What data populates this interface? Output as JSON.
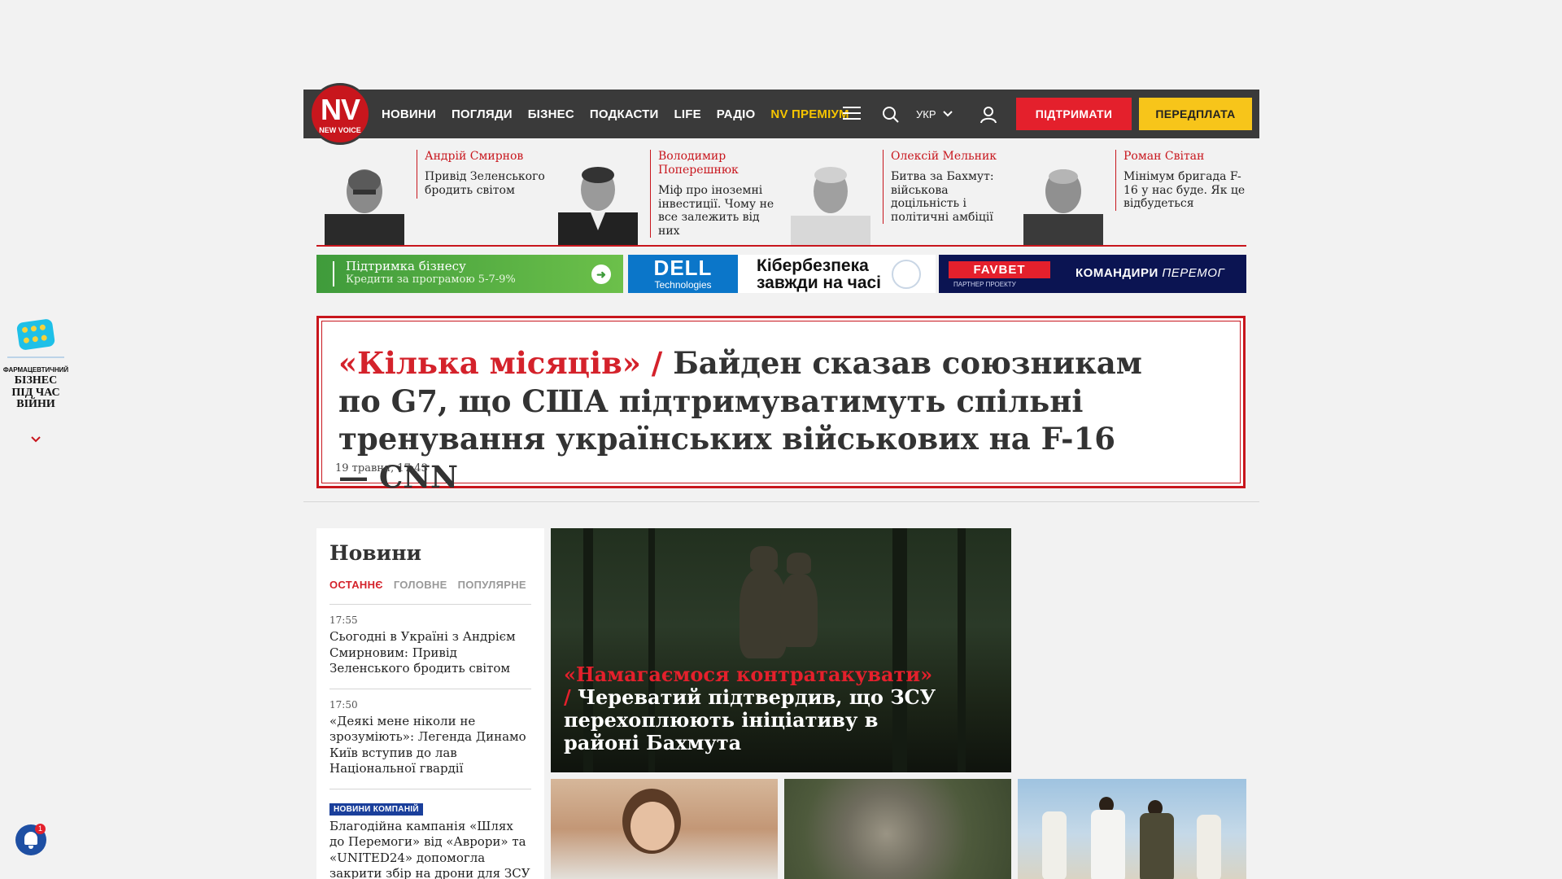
{
  "header": {
    "logo": {
      "main": "NV",
      "sub": "NEW VOICE"
    },
    "nav": [
      {
        "label": "НОВИНИ"
      },
      {
        "label": "ПОГЛЯДИ"
      },
      {
        "label": "БІЗНЕС"
      },
      {
        "label": "ПОДКАСТИ"
      },
      {
        "label": "LIFE"
      },
      {
        "label": "РАДІО"
      },
      {
        "label": "NV ПРЕМІУМ"
      }
    ],
    "icons": {
      "menu": "hamburger-menu-icon",
      "search": "search-icon",
      "user": "user-icon",
      "lang_arrow": "chevron-down-icon"
    },
    "language": "УКР",
    "support_label": "ПІДТРИМАТИ",
    "subscribe_label": "ПЕРЕДПЛАТА",
    "colors": {
      "bar": "#3a3a3a",
      "accent": "#c8161d",
      "support": "#e4202c",
      "subscribe": "#f7c51a",
      "premium": "#f5c400"
    }
  },
  "columnists": [
    {
      "author": "Андрій Смирнов",
      "title": "Привід Зеленського бродить світом"
    },
    {
      "author": "Володимир Поперешнюк",
      "title": "Міф про іноземні інвестиції. Чому не все залежить від них"
    },
    {
      "author": "Олексій Мельник",
      "title": "Битва за Бахмут: військова доцільність і політичні амбіції"
    },
    {
      "author": "Роман Світан",
      "title": "Мінімум бригада F-16 у нас буде. Як це відбудеться"
    }
  ],
  "banners": {
    "business": {
      "line1": "Підтримка бізнесу",
      "line2": "Кредити за програмою 5-7-9%"
    },
    "dell": {
      "logo_main": "DELL",
      "logo_sub": "Technologies",
      "line1": "Кібербезпека",
      "line2": "завжди на часі"
    },
    "favbet": {
      "logo": "FAVBET",
      "partner": "ПАРТНЕР ПРОЕКТУ",
      "cmd_main": "КОМАНДИРИ",
      "cmd_italic": "ПЕРЕМОГ"
    }
  },
  "side_widget": {
    "small": "ФАРМАЦЕВТИЧНИЙ",
    "title_lines": [
      "БІЗНЕС",
      "ПІД ЧАС",
      "ВІЙНИ"
    ],
    "chevron": "⌄"
  },
  "hero": {
    "kicker": "«Кілька місяців» /",
    "title": "Байден сказав союзникам по G7, що США підтримуватимуть спільні тренування українських військових на F-16 — CNN",
    "date": "19 травня, 17:43"
  },
  "news": {
    "title": "Новини",
    "tabs": [
      "ОСТАННЄ",
      "ГОЛОВНЕ",
      "ПОПУЛЯРНЕ"
    ],
    "items": [
      {
        "time": "17:55",
        "text": "Сьогодні в Україні з Андрієм Смирновим: Привід Зеленського бродить світом"
      },
      {
        "time": "17:50",
        "text": "«Деякі мене ніколи не зрозуміють»: Легенда Динамо Київ вступив до лав Національної гвардії"
      },
      {
        "badge": "НОВИНИ КОМПАНІЙ",
        "text": "Благодійна кампанія «Шлях до Перемоги» від «Аврори» та «UNITED24» допомогла закрити збір на дрони для ЗСУ"
      }
    ]
  },
  "main_story": {
    "kicker": "«Намагаємося контратакувати» /",
    "title": "Череватий підтвердив, що ЗСУ перехоплюють ініціативу в районі Бахмута"
  },
  "notifications": {
    "icon": "bell-icon",
    "count": "1"
  }
}
